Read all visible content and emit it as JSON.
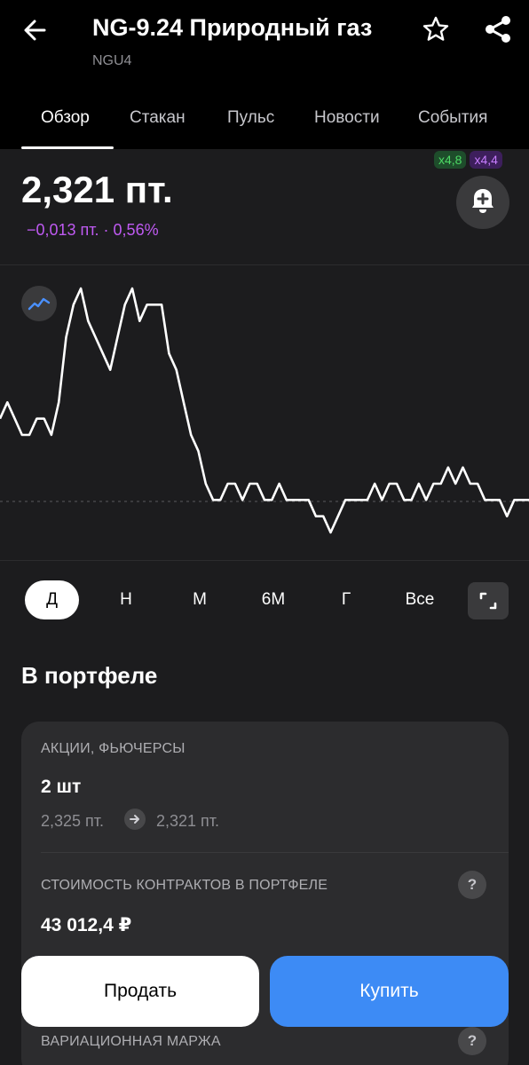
{
  "header": {
    "title": "NG-9.24 Природный газ",
    "ticker": "NGU4",
    "icons": {
      "back": "arrow-left-icon",
      "favorite": "star-outline-icon",
      "share": "share-icon"
    }
  },
  "tabs": [
    {
      "label": "Обзор",
      "active": true
    },
    {
      "label": "Стакан",
      "active": false
    },
    {
      "label": "Пульс",
      "active": false
    },
    {
      "label": "Новости",
      "active": false
    },
    {
      "label": "События",
      "active": false
    }
  ],
  "quote": {
    "badge_green": "x4,8",
    "badge_purple": "x4,4",
    "price": "2,321 пт.",
    "change": "−0,013 пт. · 0,56%",
    "colors": {
      "change": "#bf5af2",
      "badge_green": "#4cd964",
      "badge_purple": "#c77dff"
    }
  },
  "chart_data": {
    "type": "line",
    "series_color": "#ffffff",
    "y": [
      2.326,
      2.327,
      2.326,
      2.325,
      2.325,
      2.326,
      2.326,
      2.325,
      2.327,
      2.331,
      2.333,
      2.334,
      2.332,
      2.331,
      2.33,
      2.329,
      2.331,
      2.333,
      2.334,
      2.332,
      2.333,
      2.333,
      2.333,
      2.33,
      2.329,
      2.327,
      2.325,
      2.324,
      2.322,
      2.321,
      2.321,
      2.322,
      2.322,
      2.321,
      2.322,
      2.322,
      2.321,
      2.321,
      2.322,
      2.321,
      2.321,
      2.321,
      2.321,
      2.32,
      2.32,
      2.319,
      2.32,
      2.321,
      2.321,
      2.321,
      2.321,
      2.322,
      2.321,
      2.322,
      2.322,
      2.321,
      2.321,
      2.322,
      2.321,
      2.322,
      2.322,
      2.323,
      2.322,
      2.323,
      2.322,
      2.322,
      2.321,
      2.321,
      2.321,
      2.32,
      2.321,
      2.321,
      2.321
    ],
    "reference_line": "dashed",
    "grid": false
  },
  "periods": [
    {
      "label": "Д",
      "active": true
    },
    {
      "label": "Н",
      "active": false
    },
    {
      "label": "М",
      "active": false
    },
    {
      "label": "6М",
      "active": false
    },
    {
      "label": "Г",
      "active": false
    },
    {
      "label": "Все",
      "active": false
    }
  ],
  "portfolio": {
    "title": "В портфеле",
    "section1_label": "АКЦИИ, ФЬЮЧЕРСЫ",
    "quantity": "2 шт",
    "avg_price": "2,325 пт.",
    "current_price": "2,321 пт.",
    "section2_label": "СТОИМОСТЬ КОНТРАКТОВ В ПОРТФЕЛЕ",
    "contracts_value": "43 012,4 ₽",
    "section3_label": "ВАРИАЦИОННАЯ МАРЖА",
    "help_glyph": "?"
  },
  "actions": {
    "sell": "Продать",
    "buy": "Купить"
  }
}
